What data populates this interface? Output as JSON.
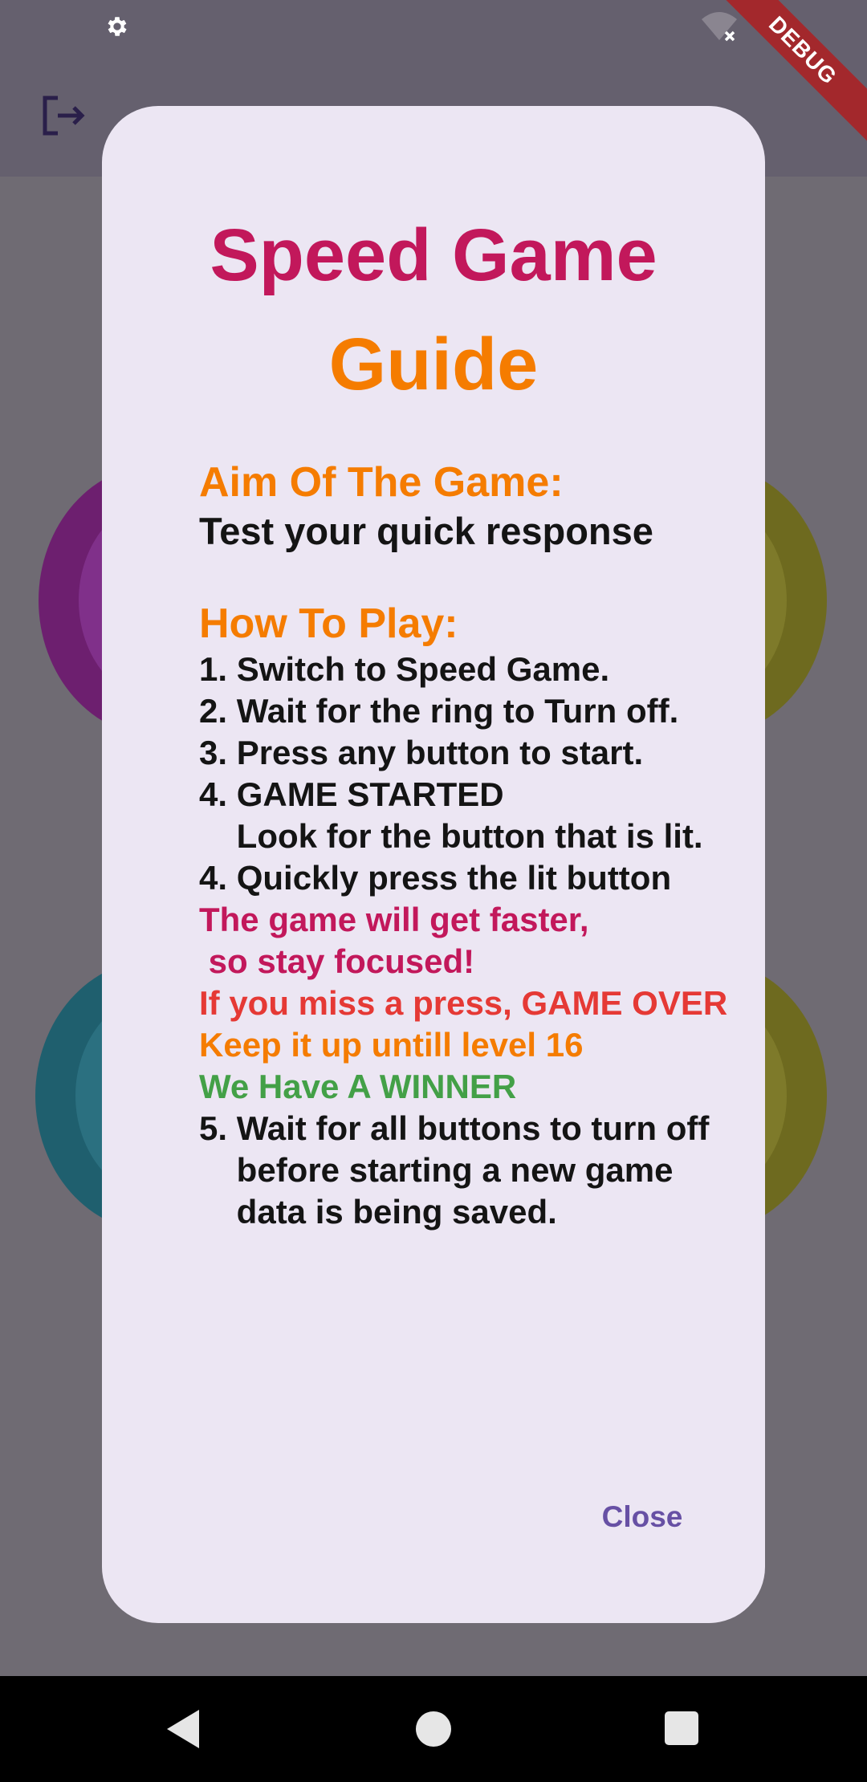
{
  "status_bar": {
    "settings_icon": "gear-icon",
    "wifi_icon": "wifi-off-icon",
    "debug_label": "DEBUG"
  },
  "app_bar": {
    "logout_icon": "logout-icon"
  },
  "dialog": {
    "title_line1": "Speed Game",
    "title_line2": "Guide",
    "aim_heading": "Aim Of The Game:",
    "aim_text": "Test your quick response",
    "howto_heading": "How To Play:",
    "steps": [
      "1. Switch to Speed Game.",
      "2. Wait for the ring to Turn off.",
      "3. Press any button to start.",
      "4. GAME STARTED",
      "    Look for the button that is lit.",
      "4. Quickly press the lit button"
    ],
    "faster_line1": "The game will get faster,",
    "faster_line2": " so stay focused!",
    "miss_text": "If you miss a press, GAME OVER",
    "keep_text": "Keep it up untill level 16",
    "winner_text": "We Have A WINNER",
    "step5_line1": "5. Wait for all buttons to turn off",
    "step5_line2": "    before starting a new game",
    "step5_line3": "    data is being saved.",
    "close_label": "Close"
  },
  "colors": {
    "title_pink": "#c2185b",
    "title_orange": "#f57c00",
    "red": "#e53935",
    "green": "#43a047",
    "close_purple": "#6750a4",
    "dialog_bg": "#ece6f3"
  },
  "nav_bar": {
    "back_icon": "back-triangle-icon",
    "home_icon": "home-circle-icon",
    "recents_icon": "recents-square-icon"
  }
}
